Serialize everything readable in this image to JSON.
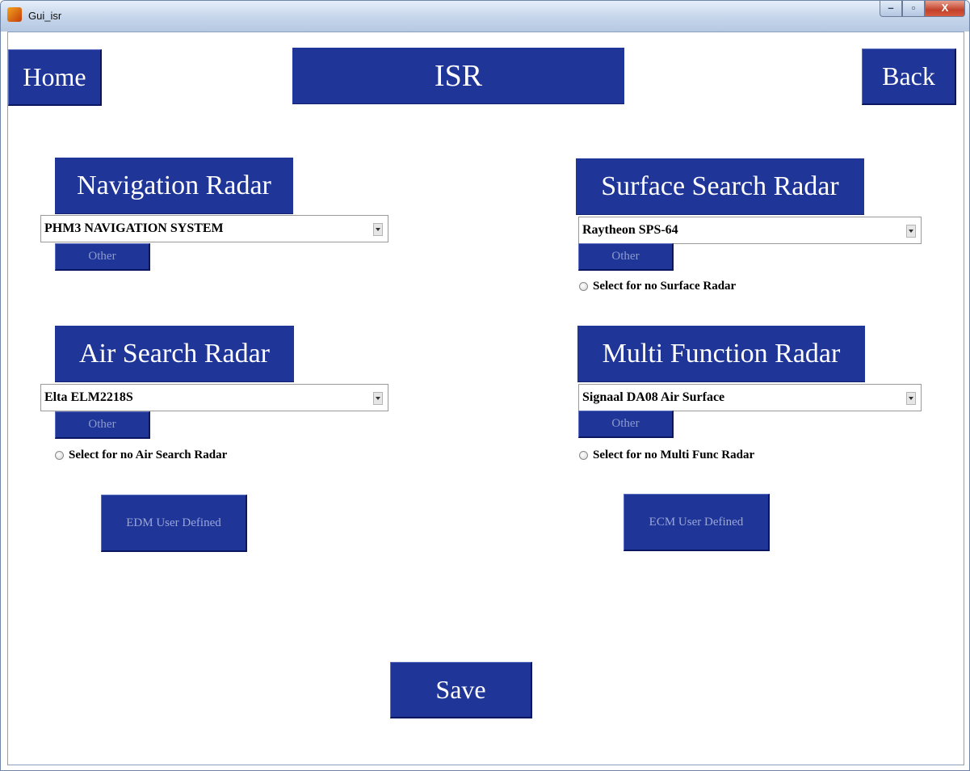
{
  "window": {
    "title": "Gui_isr",
    "controls": {
      "minimize": "–",
      "maximize": "▫",
      "close": "X"
    }
  },
  "top": {
    "home_label": "Home",
    "page_title": "ISR",
    "back_label": "Back"
  },
  "navigation_radar": {
    "header": "Navigation Radar",
    "selected": "PHM3 NAVIGATION SYSTEM",
    "other_label": "Other"
  },
  "surface_search_radar": {
    "header": "Surface Search Radar",
    "selected": "Raytheon SPS-64",
    "other_label": "Other",
    "radio_label": "Select for no Surface Radar"
  },
  "air_search_radar": {
    "header": "Air Search Radar",
    "selected": "Elta ELM2218S",
    "other_label": "Other",
    "radio_label": "Select for no Air Search Radar"
  },
  "multi_function_radar": {
    "header": "Multi Function Radar",
    "selected": "Signaal DA08 Air Surface",
    "other_label": "Other",
    "radio_label": "Select for no Multi Func Radar"
  },
  "edm_button_label": "EDM User Defined",
  "ecm_button_label": "ECM User Defined",
  "save_label": "Save",
  "colors": {
    "panel_blue": "#1f3598",
    "background": "#ffffff"
  }
}
